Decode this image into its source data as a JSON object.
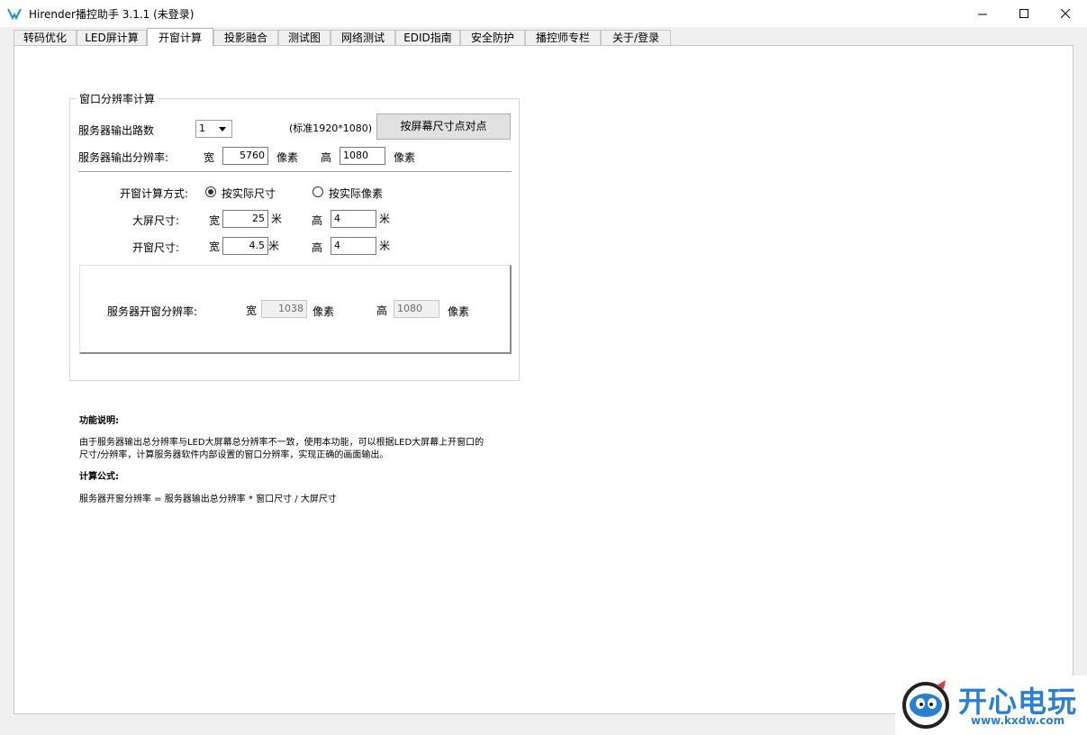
{
  "window": {
    "title": "Hirender播控助手 3.1.1 (未登录)",
    "minimize_icon": "minimize-icon",
    "maximize_icon": "maximize-icon",
    "close_icon": "close-icon"
  },
  "tabs": [
    {
      "label": "转码优化"
    },
    {
      "label": "LED屏计算"
    },
    {
      "label": "开窗计算",
      "active": true
    },
    {
      "label": "投影融合"
    },
    {
      "label": "测试图"
    },
    {
      "label": "网络测试"
    },
    {
      "label": "EDID指南"
    },
    {
      "label": "安全防护"
    },
    {
      "label": "播控师专栏"
    },
    {
      "label": "关于/登录"
    }
  ],
  "group": {
    "title": "窗口分辨率计算",
    "server_outputs_label": "服务器输出路数",
    "server_outputs_value": "1",
    "standard_note": "(标准1920*1080)",
    "dot_button": "按屏幕尺寸点对点",
    "resolution_label": "服务器输出分辨率:",
    "width_label": "宽",
    "height_label": "高",
    "pixel_unit": "像素",
    "res_width": "5760",
    "res_height": "1080",
    "method_label": "开窗计算方式:",
    "method_option_size": "按实际尺寸",
    "method_option_pixel": "按实际像素",
    "screen_size_label": "大屏尺寸:",
    "window_size_label": "开窗尺寸:",
    "meter_unit": "米",
    "screen_width": "25",
    "screen_height": "4",
    "window_width": "4.5",
    "window_height": "4",
    "result_label": "服务器开窗分辨率:",
    "result_width": "1038",
    "result_height": "1080"
  },
  "notes": {
    "func_title": "功能说明:",
    "func_line1": "由于服务器输出总分辨率与LED大屏幕总分辨率不一致，使用本功能，可以根据LED大屏幕上开窗口的",
    "func_line2": "尺寸/分辨率，计算服务器软件内部设置的窗口分辨率，实现正确的画面输出。",
    "formula_title": "计算公式:",
    "formula": "服务器开窗分辨率 = 服务器输出总分辨率 * 窗口尺寸 / 大屏尺寸"
  },
  "watermark": {
    "brand": "开心电玩",
    "url": "www.kxdw.com"
  },
  "colors": {
    "accent": "#1e8fd8",
    "watermark_blue": "#2b7fd0"
  }
}
